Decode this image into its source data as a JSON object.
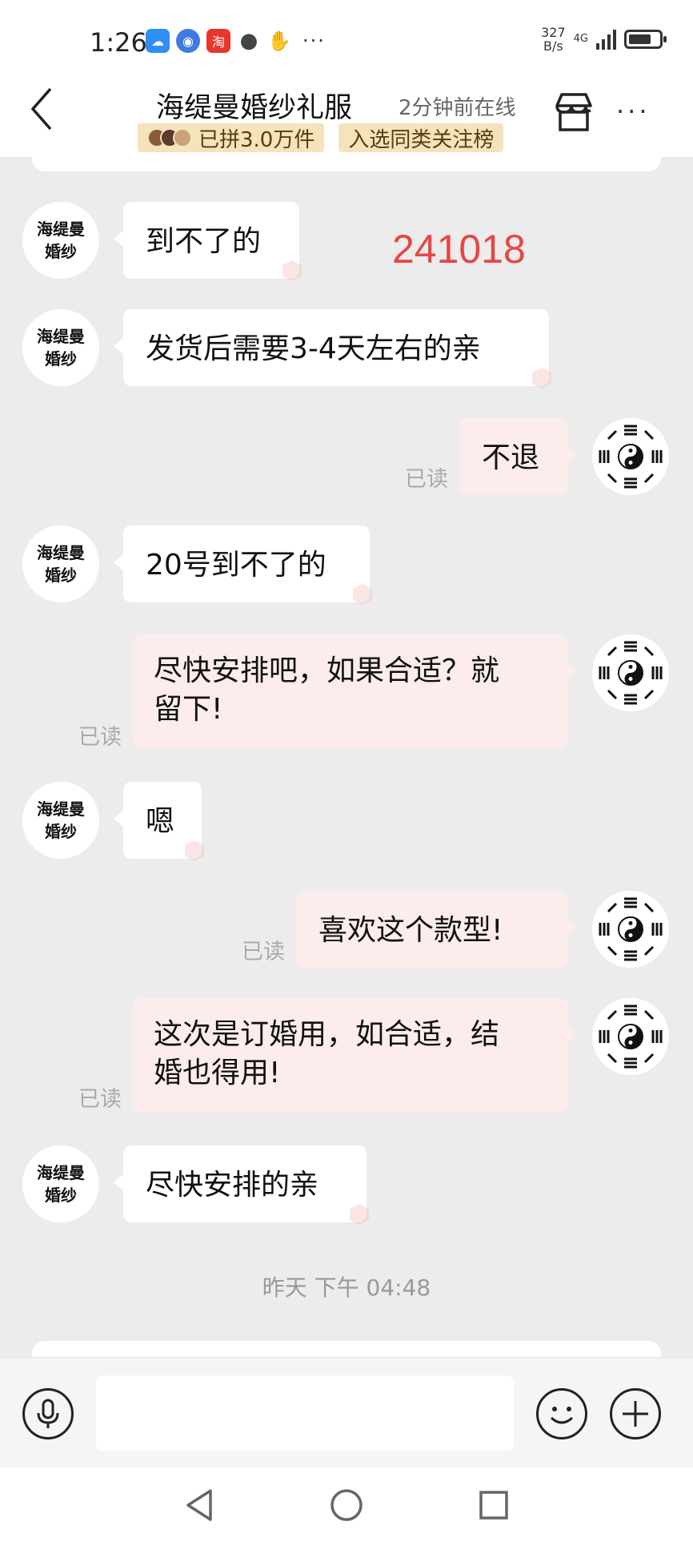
{
  "status_bar": {
    "time": "1:26",
    "app_icons": [
      {
        "name": "weather-app-icon",
        "color": "#2f8ef4",
        "glyph": "☁"
      },
      {
        "name": "browser-app-icon",
        "color": "#3d7be0",
        "glyph": "◉"
      },
      {
        "name": "taobao-app-icon",
        "color": "#e8362d",
        "glyph": "淘"
      },
      {
        "name": "message-app-icon",
        "color": "#444444",
        "glyph": "●"
      },
      {
        "name": "gesture-app-icon",
        "color": "#444444",
        "glyph": "✋"
      }
    ],
    "more": "···",
    "net_speed_value": "327",
    "net_speed_unit": "B/s",
    "network": "4G",
    "battery_level": 0.75
  },
  "header": {
    "shop_name": "海缇曼婚纱礼服",
    "online_status": "2分钟前在线",
    "badge_sold": "已拼3.0万件",
    "badge_rank": "入选同类关注榜",
    "more": "···"
  },
  "overlay_number": "241018",
  "shop_avatar": {
    "line1": "海缇曼",
    "line2": "婚纱"
  },
  "messages": [
    {
      "sender": "shop",
      "text": "到不了的"
    },
    {
      "sender": "shop",
      "text": "发货后需要3-4天左右的亲"
    },
    {
      "sender": "me",
      "text": "不退",
      "read": "已读"
    },
    {
      "sender": "shop",
      "text": "20号到不了的"
    },
    {
      "sender": "me",
      "line1": "尽快安排吧，如果合适？就",
      "line2": "留下!",
      "read": "已读"
    },
    {
      "sender": "shop",
      "text": "嗯"
    },
    {
      "sender": "me",
      "text": "喜欢这个款型!",
      "read": "已读"
    },
    {
      "sender": "me",
      "line1": "这次是订婚用，如合适，结",
      "line2": "婚也得用!",
      "read": "已读"
    },
    {
      "sender": "shop",
      "text": "尽快安排的亲"
    }
  ],
  "timestamp": "昨天 下午 04:48",
  "input": {
    "placeholder": ""
  },
  "colors": {
    "incoming_bubble": "#ffffff",
    "outgoing_bubble": "#fdecec",
    "badge_bg": "#f4e3bd",
    "overlay": "#e84545"
  }
}
